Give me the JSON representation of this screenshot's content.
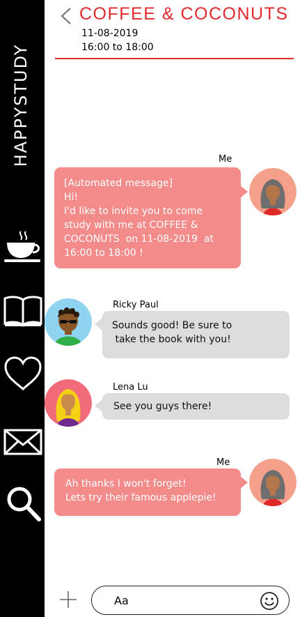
{
  "sidebar": {
    "brand": "HAPPYSTUDY",
    "icons": [
      "coffee-cup-icon",
      "book-icon",
      "heart-icon",
      "mail-icon",
      "search-icon"
    ]
  },
  "header": {
    "title": "COFFEE & COCONUTS",
    "date": "11-08-2019",
    "time": "16:00 to  18:00",
    "accent_color": "#e32a2e"
  },
  "messages": [
    {
      "sender": "Me",
      "lines": [
        "[Automated message]",
        "Hi!",
        "I'd like to invite you to come",
        "study with me at COFFEE &",
        "COCONUTS  on 11-08-2019  at",
        "16:00 to 18:00 !"
      ]
    },
    {
      "sender": "Ricky Paul",
      "lines": [
        "Sounds good! Be sure to",
        " take the book with you!"
      ]
    },
    {
      "sender": "Lena Lu",
      "lines": [
        "See you guys there!"
      ]
    },
    {
      "sender": "Me",
      "lines": [
        "Ah thanks I won't forget!",
        "Lets try their famous applepie!"
      ]
    }
  ],
  "colors": {
    "my_bubble": "#f28b8a",
    "other_bubble": "#dcdcdc",
    "sidebar": "#000000"
  },
  "composer": {
    "value": "Aa",
    "add_icon": "plus-icon",
    "emoji_icon": "smiley-icon"
  }
}
